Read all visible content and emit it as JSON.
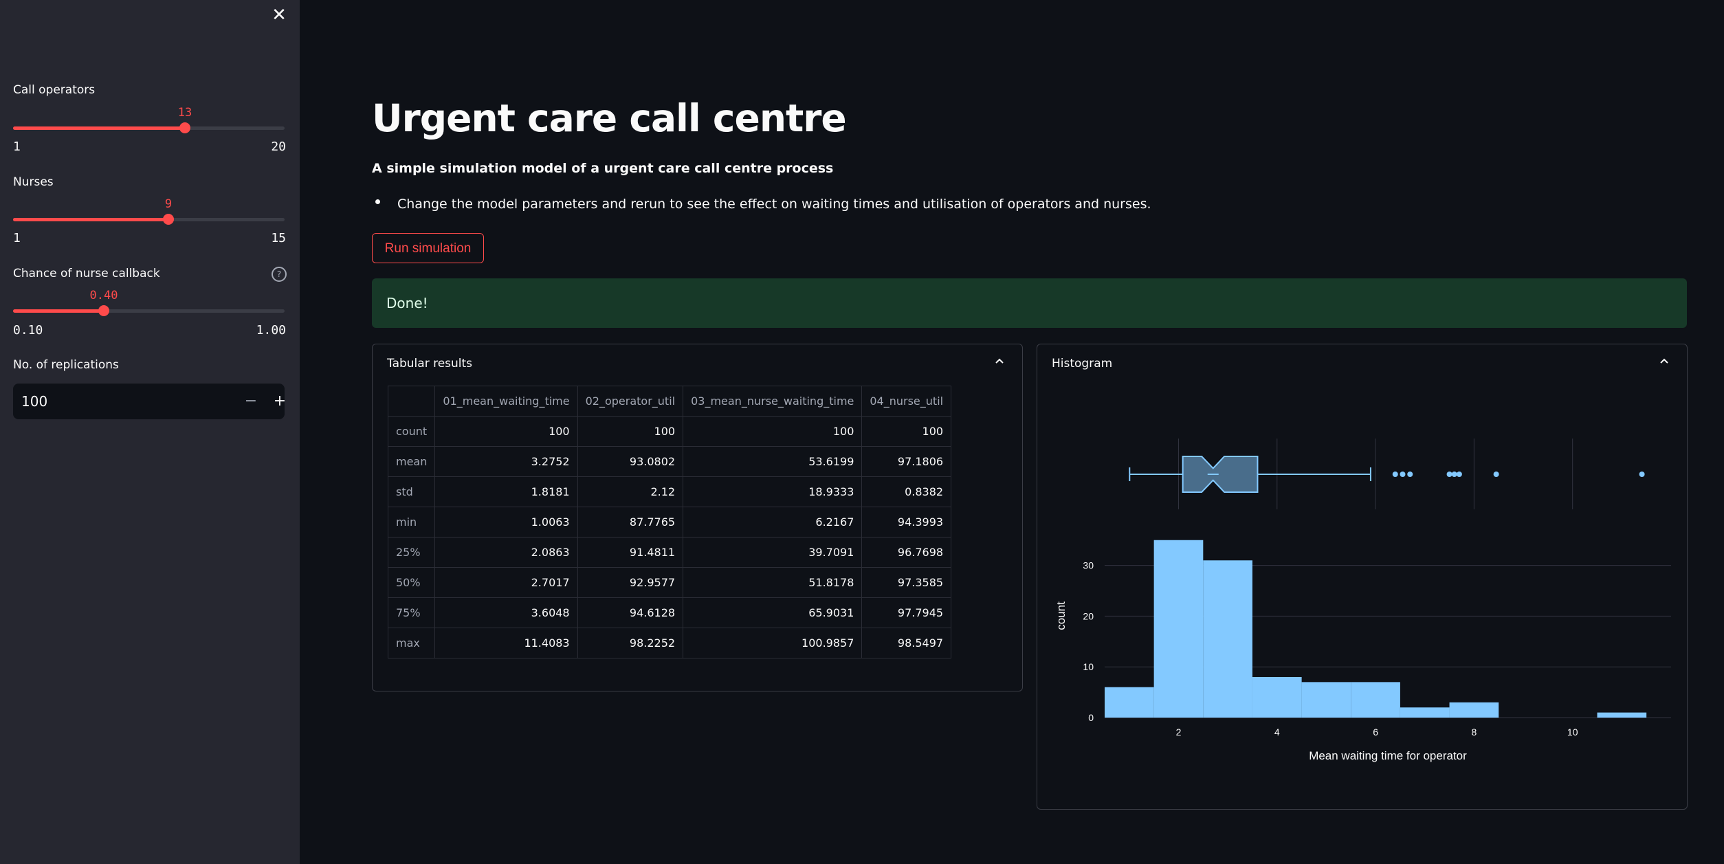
{
  "sidebar": {
    "close_icon": "close-icon",
    "sliders": [
      {
        "label": "Call operators",
        "value": "13",
        "min": "1",
        "max": "20",
        "fraction": 0.632
      },
      {
        "label": "Nurses",
        "value": "9",
        "min": "1",
        "max": "15",
        "fraction": 0.571
      },
      {
        "label": "Chance of nurse callback",
        "value": "0.40",
        "min": "0.10",
        "max": "1.00",
        "fraction": 0.333,
        "help_icon": "question-circle-icon"
      }
    ],
    "replications": {
      "label": "No. of replications",
      "value": "100",
      "minus": "−",
      "plus": "+"
    }
  },
  "main": {
    "title": "Urgent care call centre",
    "subtitle": "A simple simulation model of a urgent care call centre process",
    "bullet": "Change the model parameters and rerun to see the effect on waiting times and utilisation of operators and nurses.",
    "run_button": "Run simulation",
    "status": "Done!"
  },
  "tabular": {
    "header": "Tabular results",
    "columns": [
      "",
      "01_mean_waiting_time",
      "02_operator_util",
      "03_mean_nurse_waiting_time",
      "04_nurse_util"
    ],
    "rows": [
      [
        "count",
        "100",
        "100",
        "100",
        "100"
      ],
      [
        "mean",
        "3.2752",
        "93.0802",
        "53.6199",
        "97.1806"
      ],
      [
        "std",
        "1.8181",
        "2.12",
        "18.9333",
        "0.8382"
      ],
      [
        "min",
        "1.0063",
        "87.7765",
        "6.2167",
        "94.3993"
      ],
      [
        "25%",
        "2.0863",
        "91.4811",
        "39.7091",
        "96.7698"
      ],
      [
        "50%",
        "2.7017",
        "92.9577",
        "51.8178",
        "97.3585"
      ],
      [
        "75%",
        "3.6048",
        "94.6128",
        "65.9031",
        "97.7945"
      ],
      [
        "max",
        "11.4083",
        "98.2252",
        "100.9857",
        "98.5497"
      ]
    ]
  },
  "histogram_panel": {
    "header": "Histogram"
  },
  "chart_data": {
    "type": "bar",
    "xlabel": "Mean waiting time for operator",
    "ylabel": "count",
    "xlim": [
      0.5,
      12.0
    ],
    "ylim": [
      0,
      37
    ],
    "x_ticks": [
      2,
      4,
      6,
      8,
      10
    ],
    "y_ticks": [
      0,
      10,
      20,
      30
    ],
    "bins": [
      {
        "x0": 0.5,
        "x1": 1.5,
        "count": 6
      },
      {
        "x0": 1.5,
        "x1": 2.5,
        "count": 35
      },
      {
        "x0": 2.5,
        "x1": 3.5,
        "count": 31
      },
      {
        "x0": 3.5,
        "x1": 4.5,
        "count": 8
      },
      {
        "x0": 4.5,
        "x1": 5.5,
        "count": 7
      },
      {
        "x0": 5.5,
        "x1": 6.5,
        "count": 7
      },
      {
        "x0": 6.5,
        "x1": 7.5,
        "count": 2
      },
      {
        "x0": 7.5,
        "x1": 8.5,
        "count": 3
      },
      {
        "x0": 8.5,
        "x1": 9.5,
        "count": 0
      },
      {
        "x0": 9.5,
        "x1": 10.5,
        "count": 0
      },
      {
        "x0": 10.5,
        "x1": 11.5,
        "count": 1
      }
    ],
    "boxplot": {
      "lower_whisker": 1.0063,
      "q1": 2.0863,
      "median": 2.7017,
      "q3": 3.6048,
      "upper_whisker": 5.9,
      "notch_low": 2.47,
      "notch_high": 2.93,
      "outliers": [
        6.4,
        6.55,
        6.7,
        7.5,
        7.6,
        7.7,
        8.45,
        11.4083
      ]
    },
    "bar_color": "#83c9ff"
  }
}
